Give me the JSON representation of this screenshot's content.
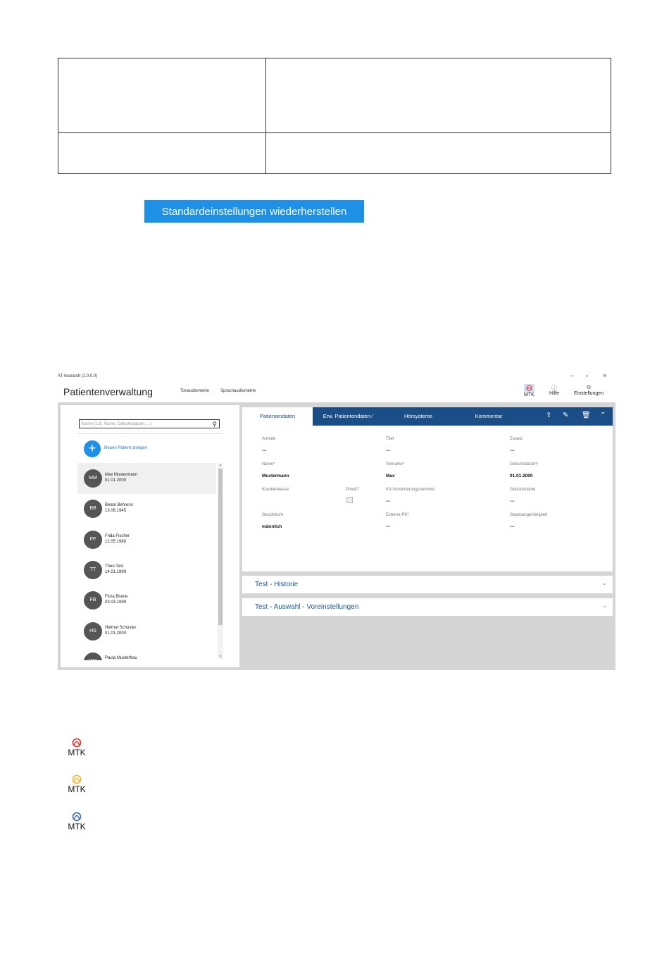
{
  "reset_button": "Standardeinstellungen wiederherstellen",
  "window": {
    "title": "AT-research (1.0.0.0)",
    "minimize": "–",
    "maximize": "▫",
    "close": "×"
  },
  "header": {
    "app_title": "Patientenverwaltung",
    "nav": [
      "Tonaudiometrie",
      "Sprachaudiometrie"
    ],
    "mtk_label": "MTK",
    "help_label": "Hilfe",
    "settings_label": "Einstellungen"
  },
  "left": {
    "search_placeholder": "Suche (z.B. Name, Geburtsdatum, ...)",
    "add_patient": "Neuen Patient anlegen",
    "patients": [
      {
        "initials": "MM",
        "name": "Max Mustermann",
        "dob": "01.01.2000"
      },
      {
        "initials": "BB",
        "name": "Beate Behrens",
        "dob": "13.06.1945"
      },
      {
        "initials": "FF",
        "name": "Frida Fischer",
        "dob": "12.05.1980"
      },
      {
        "initials": "TT",
        "name": "Theo Test",
        "dob": "14.01.1999"
      },
      {
        "initials": "FB",
        "name": "Flora Blume",
        "dob": "03.03.1999"
      },
      {
        "initials": "HS",
        "name": "Helmut Schuster",
        "dob": "01.01.2000"
      },
      {
        "initials": "PM",
        "name": "Paula Musterfrau",
        "dob": ""
      }
    ]
  },
  "tabs": {
    "patientendaten": "Patientendaten",
    "erw": "Erw. Patientendaten ⁄",
    "hoersysteme": "Hörsysteme",
    "kommentar": "Kommentar"
  },
  "fields": {
    "anrede": {
      "label": "Anrede",
      "value": "---"
    },
    "titel": {
      "label": "Titel",
      "value": "---"
    },
    "zusatz": {
      "label": "Zusatz",
      "value": "---"
    },
    "name": {
      "label": "Name*",
      "value": "Mustermann"
    },
    "vorname": {
      "label": "Vorname*",
      "value": "Max"
    },
    "geburtsdatum": {
      "label": "Geburtsdatum*",
      "value": "01.01.2000"
    },
    "krankenkasse": {
      "label": "Krankenkasse",
      "value": ""
    },
    "privat": {
      "label": "Privat?"
    },
    "kv": {
      "label": "KV-Versicherungsnummer",
      "value": "---"
    },
    "geburtsname": {
      "label": "Geburtsname",
      "value": "---"
    },
    "geschlecht": {
      "label": "Geschlecht",
      "value": "männlich"
    },
    "externe": {
      "label": "Externe PK*",
      "value": "---"
    },
    "staat": {
      "label": "Staatsangehörigkeit",
      "value": "---"
    }
  },
  "accordions": {
    "historie": "Test - Historie",
    "auswahl": "Test - Auswahl - Voreinstellungen"
  },
  "legend": [
    {
      "label": "MTK",
      "color": "#d9302c"
    },
    {
      "label": "MTK",
      "color": "#f0b429"
    },
    {
      "label": "MTK",
      "color": "#3d6fa8"
    }
  ],
  "colors": {
    "accent": "#1e90e6",
    "tabbar": "#1b4e87"
  }
}
